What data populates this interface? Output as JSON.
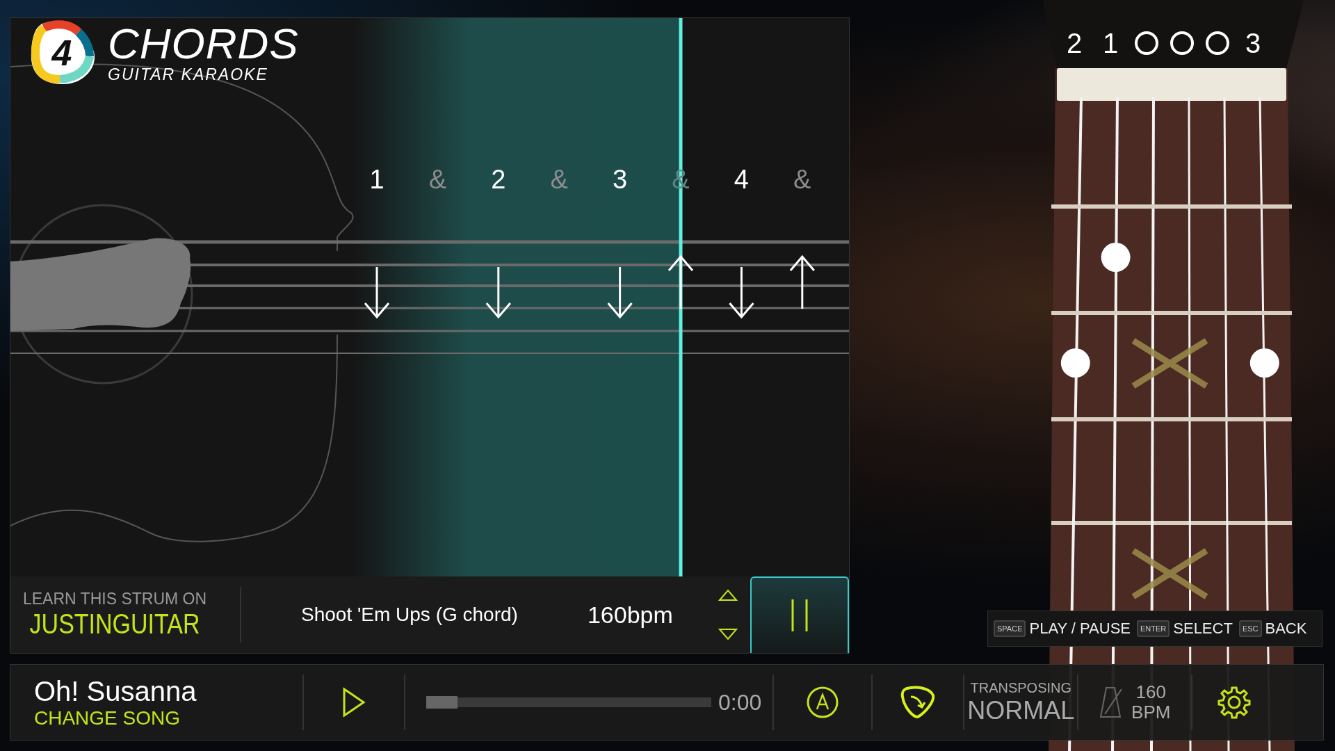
{
  "logo": {
    "badge": "4",
    "title": "CHORDS",
    "subtitle": "GUITAR KARAOKE"
  },
  "chord": {
    "strings": [
      {
        "kind": "fretted",
        "finger": "2"
      },
      {
        "kind": "fretted",
        "finger": "1"
      },
      {
        "kind": "open"
      },
      {
        "kind": "open"
      },
      {
        "kind": "open"
      },
      {
        "kind": "fretted",
        "finger": "3"
      }
    ],
    "fret_rows": [
      {
        "dots": [
          false,
          false,
          false,
          false,
          false,
          false
        ]
      },
      {
        "dots": [
          false,
          true,
          false,
          false,
          false,
          false
        ]
      },
      {
        "dots": [
          true,
          false,
          false,
          false,
          false,
          true
        ]
      }
    ]
  },
  "strum": {
    "beats": [
      {
        "label": "1",
        "kind": "count",
        "down": true,
        "up": false,
        "current": false
      },
      {
        "label": "&",
        "kind": "and",
        "down": false,
        "up": false,
        "current": false
      },
      {
        "label": "2",
        "kind": "count",
        "down": true,
        "up": false,
        "current": false
      },
      {
        "label": "&",
        "kind": "and",
        "down": false,
        "up": false,
        "current": false
      },
      {
        "label": "3",
        "kind": "count",
        "down": true,
        "up": false,
        "current": false
      },
      {
        "label": "&",
        "kind": "and",
        "down": false,
        "up": true,
        "current": true
      },
      {
        "label": "4",
        "kind": "count",
        "down": true,
        "up": false,
        "current": false
      },
      {
        "label": "&",
        "kind": "and",
        "down": false,
        "up": true,
        "current": false
      }
    ]
  },
  "lesson": {
    "prompt": "LEARN THIS STRUM ON",
    "source": "JUSTINGUITAR",
    "pattern": "Shoot 'Em Ups (G chord)",
    "tempo": "160bpm"
  },
  "key_hints": [
    {
      "key": "SPACE",
      "action": "PLAY / PAUSE"
    },
    {
      "key": "ENTER",
      "action": "SELECT"
    },
    {
      "key": "ESC",
      "action": "BACK"
    }
  ],
  "player": {
    "song": "Oh! Susanna",
    "change_song": "CHANGE SONG",
    "progress": {
      "level": 0
    },
    "time": "0:00",
    "transposing_label": "TRANSPOSING",
    "transposing_value": "NORMAL",
    "bpm_value": "160",
    "bpm_unit": "BPM"
  }
}
